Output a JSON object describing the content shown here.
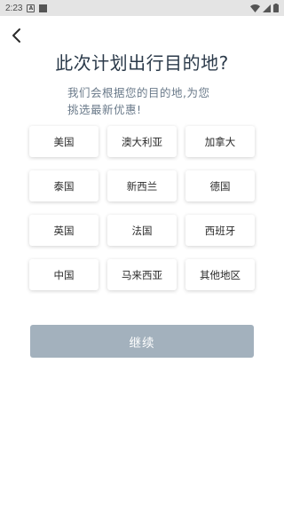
{
  "status_bar": {
    "time": "2:23",
    "notification_icon_letter": "A"
  },
  "header": {
    "back_icon": "chevron-left-icon",
    "title": "此次计划出行目的地?"
  },
  "subtitle": {
    "line1": "我们会根据您的目的地,为您",
    "line2": "挑选最新优惠!"
  },
  "countries": [
    "美国",
    "澳大利亚",
    "加拿大",
    "泰国",
    "新西兰",
    "德国",
    "英国",
    "法国",
    "西班牙",
    "中国",
    "马来西亚",
    "其他地区"
  ],
  "continue_button": {
    "label": "继续"
  },
  "colors": {
    "button_disabled": "#a3b1bd",
    "title": "#2b3a4a",
    "subtitle": "#6a7a8a"
  }
}
